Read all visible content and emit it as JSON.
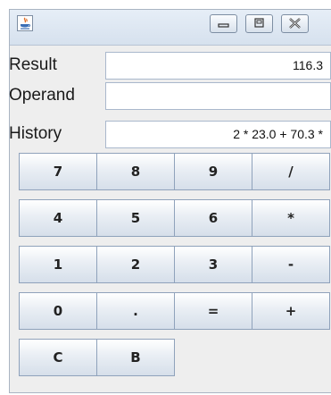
{
  "window": {
    "buttons": [
      "minimize-button",
      "maximize-button",
      "close-button"
    ]
  },
  "rows": [
    {
      "label": "Result",
      "value": "116.3"
    },
    {
      "label": "Operand",
      "value": ""
    },
    {
      "label": "History",
      "value": "2 * 23.0 + 70.3 *"
    }
  ],
  "keys": {
    "row1": [
      "7",
      "8",
      "9",
      "/"
    ],
    "row2": [
      "4",
      "5",
      "6",
      "*"
    ],
    "row3": [
      "1",
      "2",
      "3",
      "-"
    ],
    "row4": [
      "0",
      ".",
      "=",
      "+"
    ],
    "row5": [
      "C",
      "B"
    ]
  },
  "colors": {
    "window_bg": "#eeeeee",
    "titlebar": "#d6e1ee",
    "button_border": "#8fa2bb"
  }
}
